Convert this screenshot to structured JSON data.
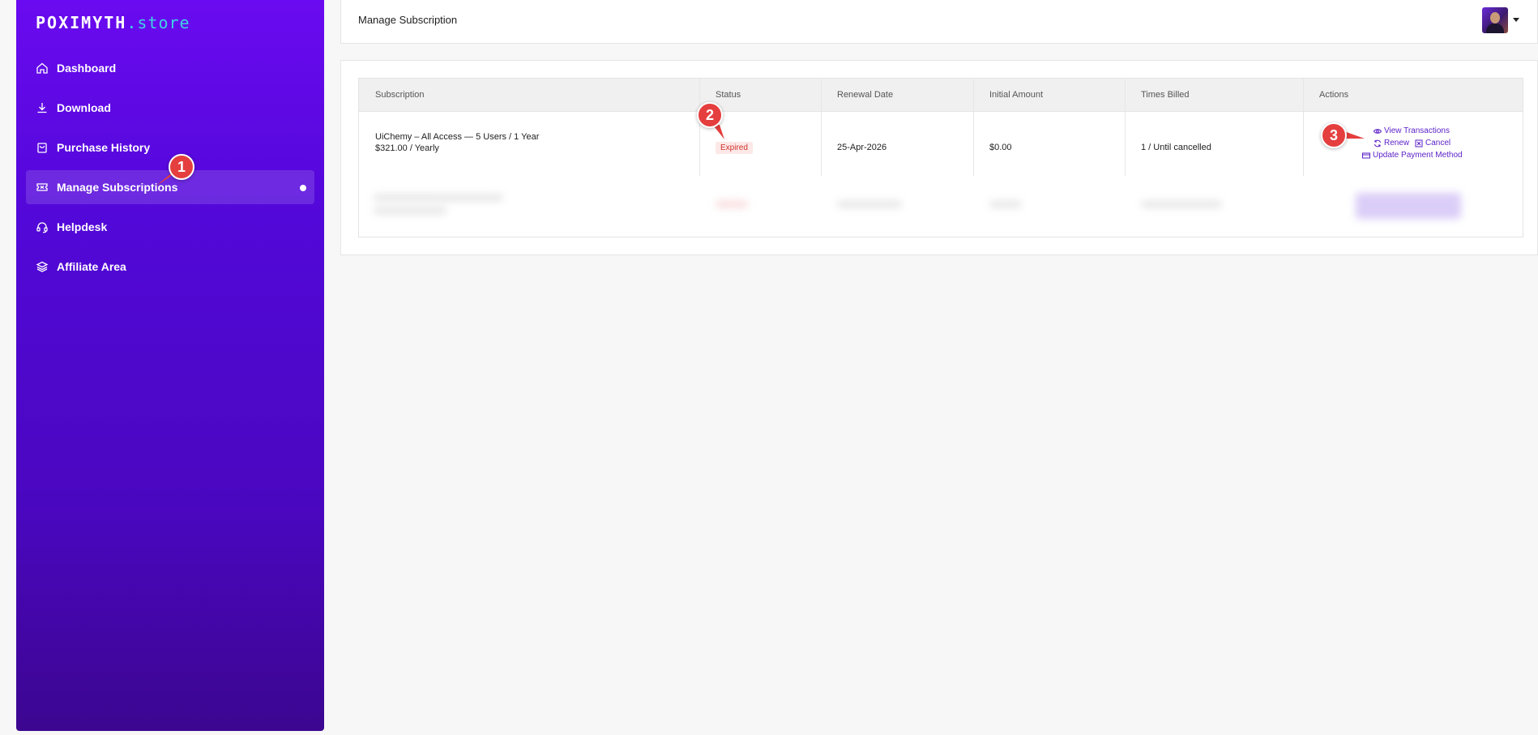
{
  "brand": {
    "name": "POXIMYTH",
    "ext": ".store"
  },
  "sidebar": {
    "items": [
      {
        "label": "Dashboard",
        "icon": "home-icon"
      },
      {
        "label": "Download",
        "icon": "download-icon"
      },
      {
        "label": "Purchase History",
        "icon": "bag-icon"
      },
      {
        "label": "Manage Subscriptions",
        "icon": "ticket-icon",
        "active": true
      },
      {
        "label": "Helpdesk",
        "icon": "headset-icon"
      },
      {
        "label": "Affiliate Area",
        "icon": "layers-icon"
      }
    ]
  },
  "header": {
    "title": "Manage Subscription",
    "avatar_icon": "user-avatar"
  },
  "table": {
    "headers": [
      "Subscription",
      "Status",
      "Renewal Date",
      "Initial Amount",
      "Times Billed",
      "Actions"
    ],
    "rows": [
      {
        "subscription_line1": "UiChemy – All Access — 5 Users / 1 Year",
        "subscription_line2": "$321.00 / Yearly",
        "status": "Expired",
        "renewal_date": "25-Apr-2026",
        "initial_amount": "$0.00",
        "times_billed": "1 / Until cancelled",
        "actions": {
          "view_transactions": "View Transactions",
          "renew": "Renew",
          "cancel": "Cancel",
          "update_payment": "Update Payment Method"
        }
      }
    ]
  },
  "annotations": [
    "1",
    "2",
    "3"
  ],
  "colors": {
    "sidebar_top": "#6a0af0",
    "sidebar_bottom": "#3c0690",
    "accent": "#5a1fc7",
    "expired": "#d0342c",
    "marker": "#e53e3e"
  }
}
